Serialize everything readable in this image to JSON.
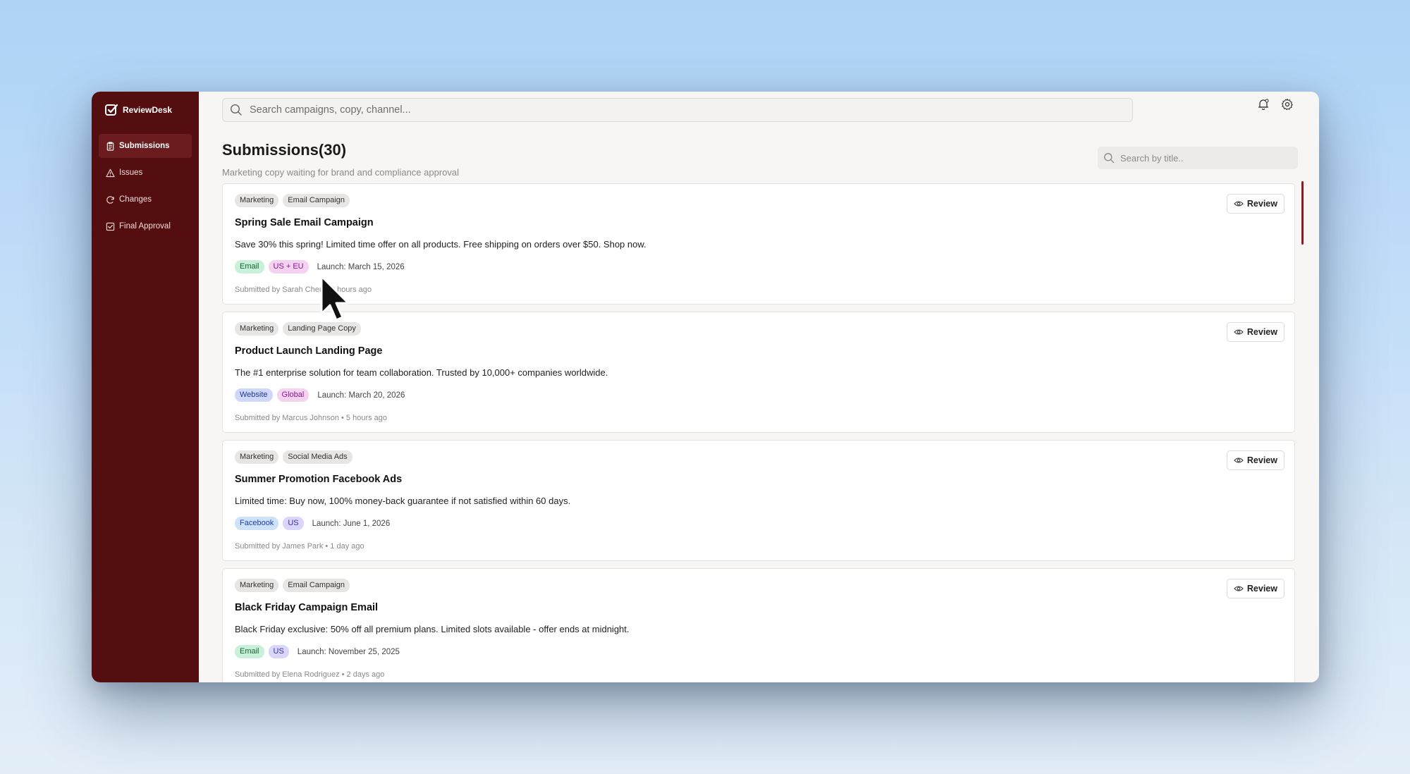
{
  "app": {
    "name": "ReviewDesk"
  },
  "sidebar": {
    "items": [
      {
        "label": "Submissions",
        "icon": "clipboard-icon",
        "active": true
      },
      {
        "label": "Issues",
        "icon": "alert-triangle-icon",
        "active": false
      },
      {
        "label": "Changes",
        "icon": "refresh-icon",
        "active": false
      },
      {
        "label": "Final Approval",
        "icon": "check-square-icon",
        "active": false
      }
    ]
  },
  "header": {
    "search_placeholder": "Search campaigns, copy, channel...",
    "icons": [
      "bell-icon",
      "gear-icon"
    ]
  },
  "page": {
    "title": "Submissions(30)",
    "subtitle": "Marketing copy waiting for brand and compliance approval",
    "title_search_placeholder": "Search by title.."
  },
  "colors": {
    "sidebar_bg": "#550e10",
    "sidebar_active": "#6b1c1f",
    "accent": "#8c1c22"
  },
  "submissions": [
    {
      "tags": [
        "Marketing",
        "Email Campaign"
      ],
      "title": "Spring Sale Email Campaign",
      "description": "Save 30% this spring! Limited time offer on all products. Free shipping on orders over $50. Shop now.",
      "channel": {
        "label": "Email",
        "bg": "#c9f0d8",
        "fg": "#166534"
      },
      "region": {
        "label": "US + EU",
        "bg": "#f4d2f0",
        "fg": "#86198f"
      },
      "launch": "Launch: March 15, 2026",
      "submitted": "Submitted by Sarah Chen • 2 hours ago",
      "review_label": "Review"
    },
    {
      "tags": [
        "Marketing",
        "Landing Page Copy"
      ],
      "title": "Product Launch Landing Page",
      "description": "The #1 enterprise solution for team collaboration. Trusted by 10,000+ companies worldwide.",
      "channel": {
        "label": "Website",
        "bg": "#cfd7fb",
        "fg": "#1e3a8a"
      },
      "region": {
        "label": "Global",
        "bg": "#f4d2f0",
        "fg": "#86198f"
      },
      "launch": "Launch: March 20, 2026",
      "submitted": "Submitted by Marcus Johnson • 5 hours ago",
      "review_label": "Review"
    },
    {
      "tags": [
        "Marketing",
        "Social Media Ads"
      ],
      "title": "Summer Promotion Facebook Ads",
      "description": "Limited time: Buy now, 100% money-back guarantee if not satisfied within 60 days.",
      "channel": {
        "label": "Facebook",
        "bg": "#cde1f9",
        "fg": "#1e40af"
      },
      "region": {
        "label": "US",
        "bg": "#d9d5fb",
        "fg": "#3730a3"
      },
      "launch": "Launch: June 1, 2026",
      "submitted": "Submitted by James Park • 1 day ago",
      "review_label": "Review"
    },
    {
      "tags": [
        "Marketing",
        "Email Campaign"
      ],
      "title": "Black Friday Campaign Email",
      "description": "Black Friday exclusive: 50% off all premium plans. Limited slots available - offer ends at midnight.",
      "channel": {
        "label": "Email",
        "bg": "#c9f0d8",
        "fg": "#166534"
      },
      "region": {
        "label": "US",
        "bg": "#d9d5fb",
        "fg": "#3730a3"
      },
      "launch": "Launch: November 25, 2025",
      "submitted": "Submitted by Elena Rodriguez • 2 days ago",
      "review_label": "Review"
    }
  ]
}
